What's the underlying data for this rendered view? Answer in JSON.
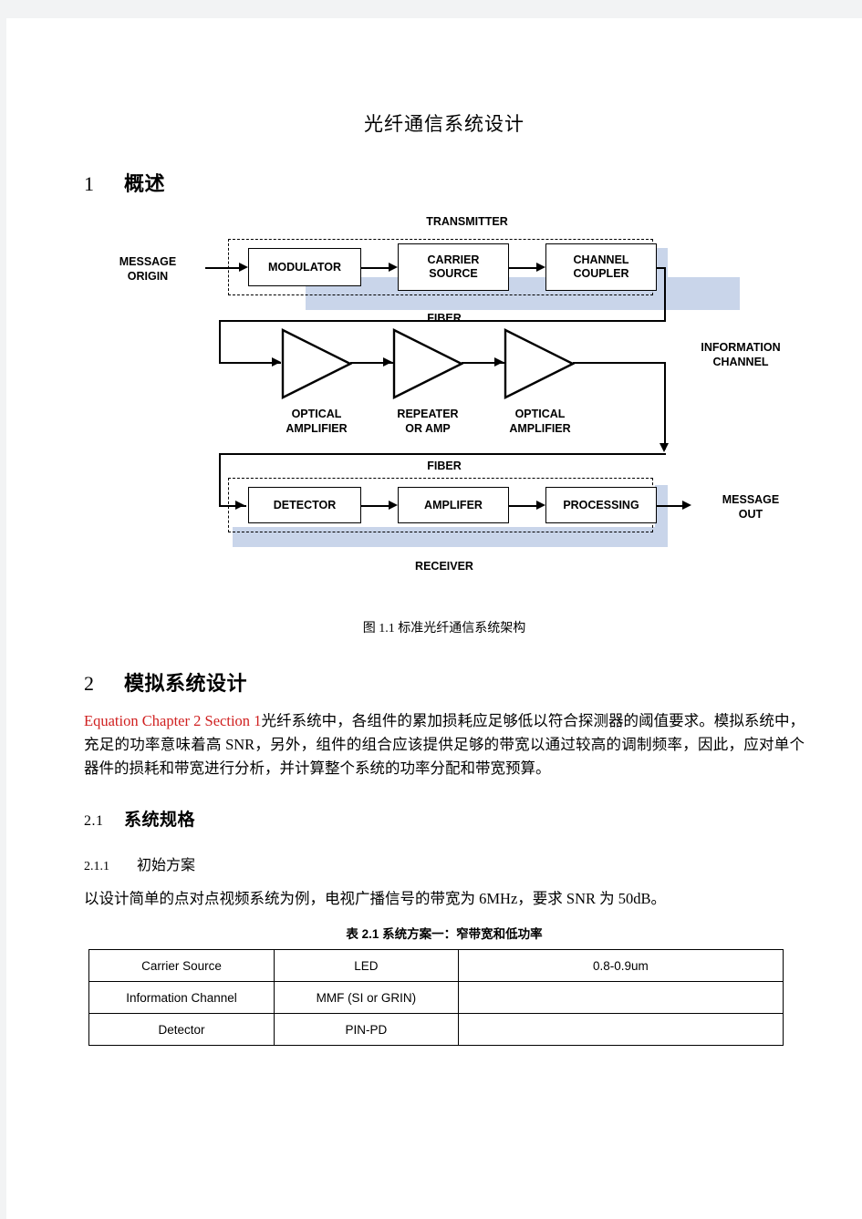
{
  "document": {
    "title": "光纤通信系统设计"
  },
  "sections": {
    "s1": {
      "num": "1",
      "title": "概述"
    },
    "s2": {
      "num": "2",
      "title": "模拟系统设计"
    },
    "s21": {
      "num": "2.1",
      "title": "系统规格"
    },
    "s211": {
      "num": "2.1.1",
      "title": "初始方案"
    }
  },
  "figure": {
    "caption": "图 1.1 标准光纤通信系统架构",
    "labels": {
      "transmitter": "TRANSMITTER",
      "message_origin": "MESSAGE\nORIGIN",
      "fiber_top": "FIBER",
      "fiber_bottom": "FIBER",
      "information_channel": "INFORMATION\nCHANNEL",
      "receiver": "RECEIVER",
      "message_out": "MESSAGE\nOUT",
      "optical_amplifier_1": "OPTICAL\nAMPLIFIER",
      "repeater_or_amp": "REPEATER\nOR  AMP",
      "optical_amplifier_2": "OPTICAL\nAMPLIFIER"
    },
    "blocks": {
      "modulator": "MODULATOR",
      "carrier_source": "CARRIER\nSOURCE",
      "channel_coupler": "CHANNEL\nCOUPLER",
      "detector": "DETECTOR",
      "amplifer": "AMPLIFER",
      "processing": "PROCESSING"
    },
    "colors": {
      "shadow": "#c9d5ea",
      "stroke": "#000000"
    }
  },
  "paragraphs": {
    "p2_prefix": "Equation Chapter 2 Section 1",
    "p2_body": "光纤系统中，各组件的累加损耗应足够低以符合探测器的阈值要求。模拟系统中，充足的功率意味着高 SNR，另外，组件的组合应该提供足够的带宽以通过较高的调制频率，因此，应对单个器件的损耗和带宽进行分析，并计算整个系统的功率分配和带宽预算。",
    "p211": "以设计简单的点对点视频系统为例，电视广播信号的带宽为 6MHz，要求 SNR 为 50dB。"
  },
  "table": {
    "caption": "表 2.1 系统方案一：窄带宽和低功率",
    "rows": [
      {
        "component": "Carrier Source",
        "device": "LED",
        "detail": "0.8-0.9um"
      },
      {
        "component": "Information  Channel",
        "device": "MMF  (SI  or  GRIN)",
        "detail": ""
      },
      {
        "component": "Detector",
        "device": "PIN-PD",
        "detail": ""
      }
    ]
  }
}
